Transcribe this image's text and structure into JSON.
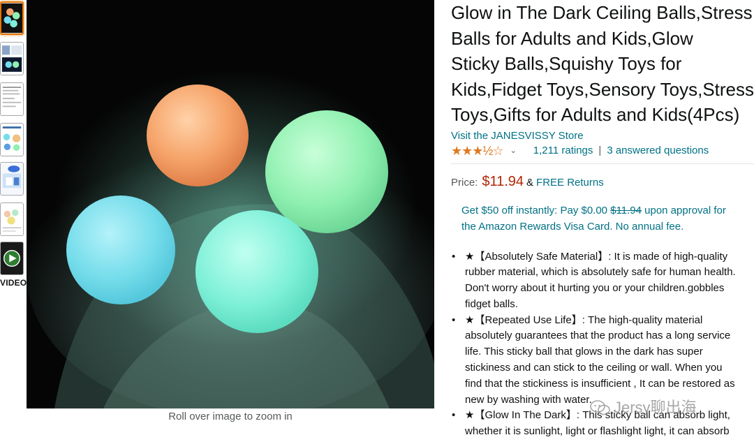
{
  "thumbnails": {
    "count": 6,
    "selected_index": 0
  },
  "video": {
    "label": "VIDEO"
  },
  "main_image": {
    "zoom_hint": "Roll over image to zoom in"
  },
  "product": {
    "title_lines": [
      "Glow in The Dark Ceiling Balls,Stress",
      "Balls for Adults and Kids,Glow",
      "Sticky Balls,Squishy Toys for",
      "Kids,Fidget Toys,Sensory Toys,Stress",
      "Toys,Gifts for Adults and Kids(4Pcs)"
    ],
    "store_link": "Visit the JANESVISSY Store",
    "stars": "★★★½☆",
    "star_rating": 3.5,
    "ratings_count": "1,211 ratings",
    "separator": "|",
    "answered_questions": "3 answered questions"
  },
  "price": {
    "label": "Price:",
    "amount": "$11.94",
    "amp": "&",
    "returns": "FREE Returns"
  },
  "promo": {
    "line1_before": "Get $50 off instantly: Pay $0.00 ",
    "line1_strike": "$11.94",
    "line1_after": " upon approval for",
    "line2": "the Amazon Rewards Visa Card. No annual fee."
  },
  "bullets": [
    {
      "lines": [
        "★【Absolutely Safe Material】: It is made of high-quality",
        "rubber material, which is absolutely safe for human health.",
        "Don't worry about it hurting you or your children.gobbles",
        "fidget balls."
      ]
    },
    {
      "lines": [
        "★【Repeated Use Life】: The high-quality material",
        "absolutely guarantees that the product has a long service",
        "life. This sticky ball that glows in the dark has super",
        "stickiness and can stick to the ceiling or wall. When you",
        "find that the stickiness is insufficient , It can be restored as",
        "new by washing with water."
      ]
    },
    {
      "lines": [
        "★【Glow In The Dark】: This sticky ball can absorb light,",
        "whether it is sunlight, light or flashlight light, it can absorb"
      ]
    }
  ],
  "watermark": {
    "text": "Jersy聊出海"
  },
  "colors": {
    "link": "#007185",
    "price": "#b12704",
    "star": "#de7921",
    "thumb_selected": "#e77600",
    "ball_orange": "#f4a36a",
    "ball_green": "#8ff0b0",
    "ball_cyan": "#74dcea",
    "ball_teal": "#7ef0d8"
  }
}
